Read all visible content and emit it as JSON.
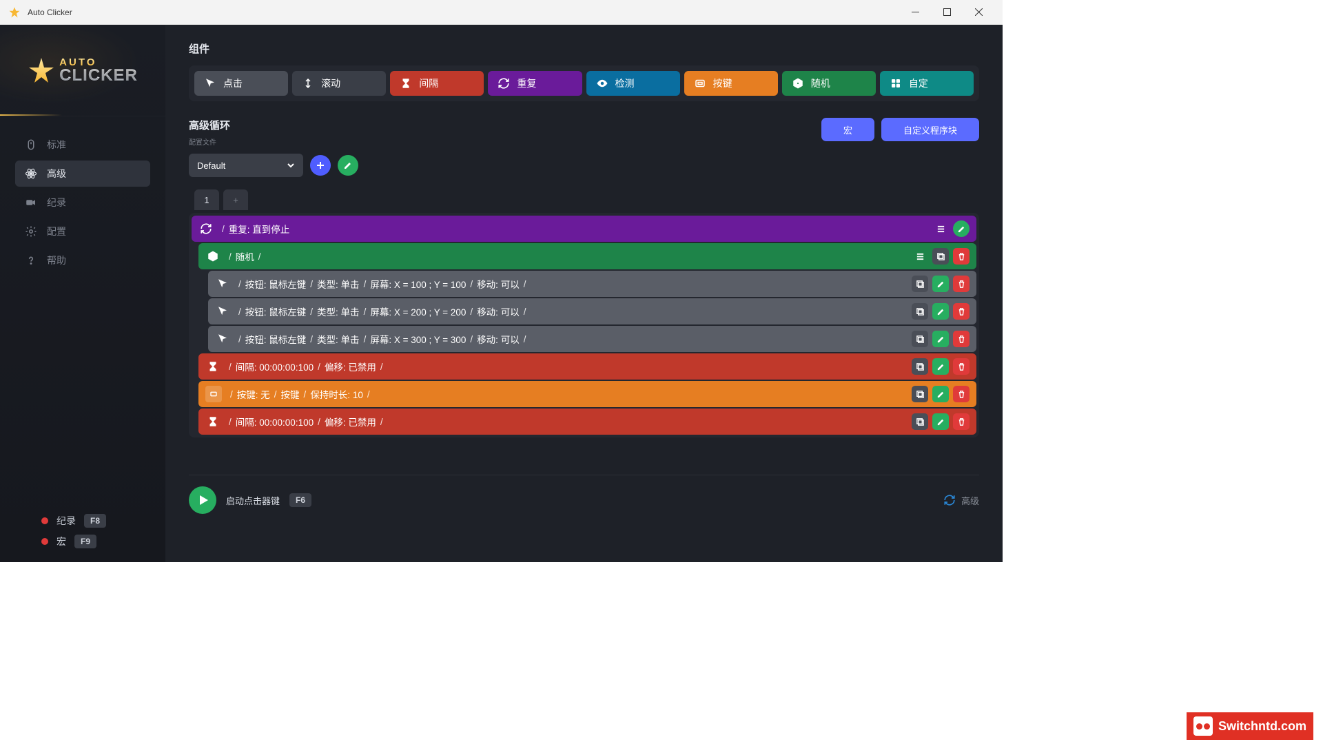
{
  "window": {
    "title": "Auto Clicker"
  },
  "logo": {
    "line1": "AUTO",
    "line2": "CLICKER"
  },
  "sidebar": {
    "items": [
      {
        "label": "标准"
      },
      {
        "label": "高级"
      },
      {
        "label": "纪录"
      },
      {
        "label": "配置"
      },
      {
        "label": "帮助"
      }
    ],
    "footer": {
      "record": {
        "label": "纪录",
        "key": "F8"
      },
      "macro": {
        "label": "宏",
        "key": "F9"
      }
    }
  },
  "components": {
    "title": "组件",
    "items": {
      "click": "点击",
      "scroll": "滚动",
      "wait": "间隔",
      "repeat": "重复",
      "detect": "检测",
      "key": "按键",
      "random": "随机",
      "custom": "自定"
    }
  },
  "loop": {
    "title": "高级循环",
    "config_label": "配置文件",
    "selected": "Default",
    "btn_macro": "宏",
    "btn_custom": "自定义程序块"
  },
  "tabs": {
    "t1": "1",
    "add": "+"
  },
  "sequence": {
    "repeat": {
      "text": "重复: 直到停止"
    },
    "random": {
      "text": "随机"
    },
    "clicks": [
      {
        "btn": "按钮: 鼠标左键",
        "type": "类型: 单击",
        "screen": "屏幕: X = 100 ; Y = 100",
        "move": "移动: 可以"
      },
      {
        "btn": "按钮: 鼠标左键",
        "type": "类型: 单击",
        "screen": "屏幕: X = 200 ; Y = 200",
        "move": "移动: 可以"
      },
      {
        "btn": "按钮: 鼠标左键",
        "type": "类型: 单击",
        "screen": "屏幕: X = 300 ; Y = 300",
        "move": "移动: 可以"
      }
    ],
    "wait1": {
      "interval": "间隔: 00:00:00:100",
      "offset": "偏移: 已禁用"
    },
    "key": {
      "key": "按键: 无",
      "method": "按键",
      "hold": "保持时长: 10"
    },
    "wait2": {
      "interval": "间隔: 00:00:00:100",
      "offset": "偏移: 已禁用"
    }
  },
  "bottom": {
    "start_label": "启动点击器键",
    "start_key": "F6",
    "advanced": "高级"
  },
  "watermark": "Switchntd.com"
}
